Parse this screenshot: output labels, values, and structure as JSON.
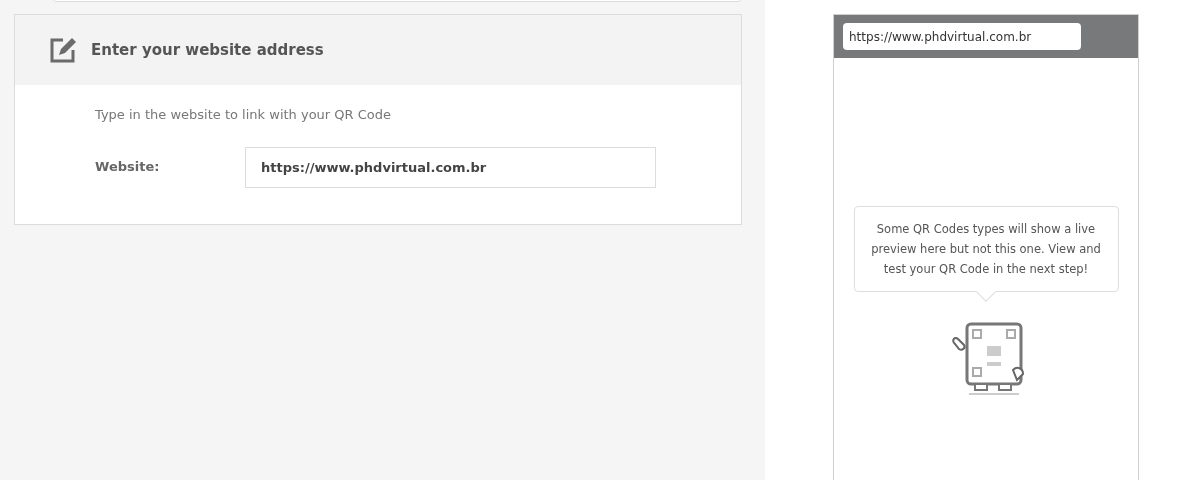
{
  "card": {
    "title": "Enter your website address",
    "description": "Type in the website to link with your QR Code",
    "field": {
      "label": "Website:",
      "value": "https://www.phdvirtual.com.br"
    }
  },
  "preview": {
    "address_bar": "https://www.phdvirtual.com.br",
    "message": "Some QR Codes types will show a live preview here but not this one. View and test your QR Code in the next step!"
  }
}
